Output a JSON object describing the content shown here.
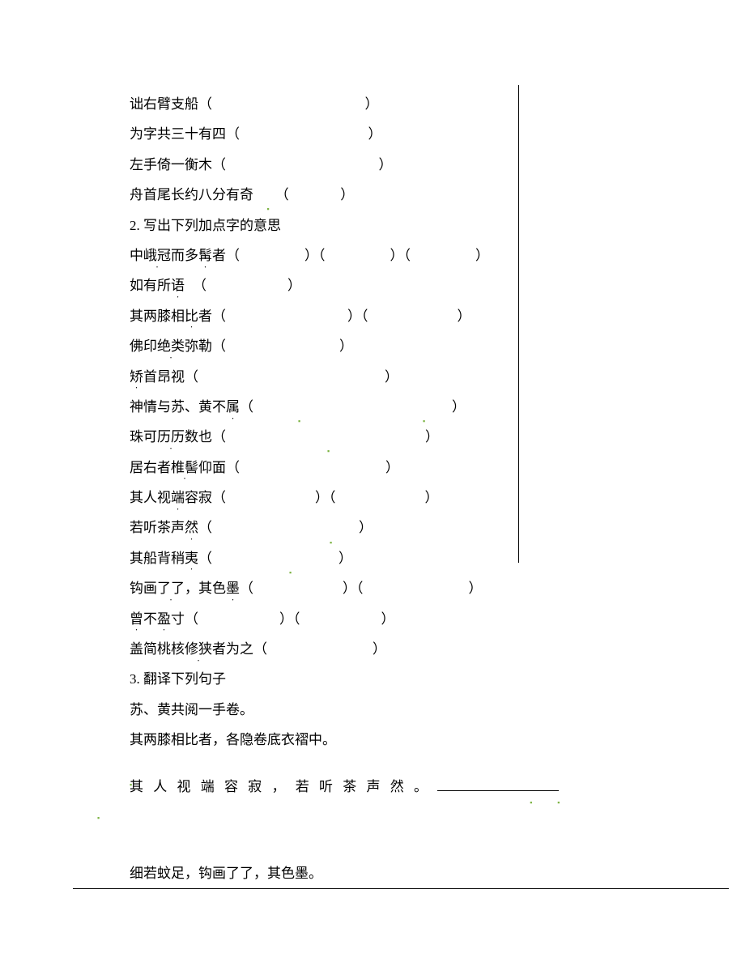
{
  "lines": {
    "l1": "诎右臂支船（",
    "l1_close": "）",
    "l2": "为字共三十有四（",
    "l2_close": "）",
    "l3": "左手倚一衡木（",
    "l3_close": "）",
    "l4_a": "舟首尾长约八分有奇",
    "l4_b": "（",
    "l4_c": "）",
    "q2_title": "2. 写出下列加点字的意思",
    "l5_a": "中",
    "l5_b": "峨冠",
    "l5_c": "而多",
    "l5_d": "髯",
    "l5_e": "者（",
    "l5_f": "）（",
    "l5_g": "）（",
    "l5_h": "）",
    "l6": "如有所",
    "l6_b": "语",
    "l6_c": "（",
    "l6_d": "）",
    "l7_a": "其两膝相",
    "l7_b": "比",
    "l7_c": "者（",
    "l7_d": "）（",
    "l7_e": "）",
    "l8_a": "佛印",
    "l8_b": "绝类",
    "l8_c": "弥勒（",
    "l8_d": "）",
    "l9_a": "矫",
    "l9_b": "首昂视（",
    "l9_c": "）",
    "l10_a": "神情与苏、黄不",
    "l10_b": "属",
    "l10_c": "（",
    "l10_d": "）",
    "l11_a": "珠可",
    "l11_b": "历历",
    "l11_c": "数也（",
    "l11_d": "）",
    "l12_a": "居右者",
    "l12_b": "椎髻",
    "l12_c": "仰面（",
    "l12_d": "）",
    "l13_a": "其人视",
    "l13_b": "端",
    "l13_c": "容寂（",
    "l13_d": "）（",
    "l13_e": "）",
    "l14_a": "若听茶声",
    "l14_b": "然",
    "l14_c": "（",
    "l14_d": "）",
    "l15_a": "其船背稍",
    "l15_b": "夷",
    "l15_c": "（",
    "l15_d": "）",
    "l16_a": "钩画",
    "l16_b": "了了",
    "l16_c": "，其色",
    "l16_d": "墨",
    "l16_e": "（",
    "l16_f": "）（",
    "l16_g": "）",
    "l17_a": "曾",
    "l17_b": "不",
    "l17_c": "盈",
    "l17_d": "寸（",
    "l17_e": "）（",
    "l17_f": "）",
    "l18_a": "盖简桃核",
    "l18_b": "修狭",
    "l18_c": "者为之（",
    "l18_d": "）",
    "q3_title": "3. 翻译下列句子",
    "l19": "苏、黄共阅一手卷。",
    "l20": "其两膝相比者，各隐卷底衣褶中。",
    "l21_a": "其 人 视 端 容 寂 ， 若 听 茶 声 然 。",
    "l22": "细若蚊足，钩画了了，其色墨。"
  }
}
